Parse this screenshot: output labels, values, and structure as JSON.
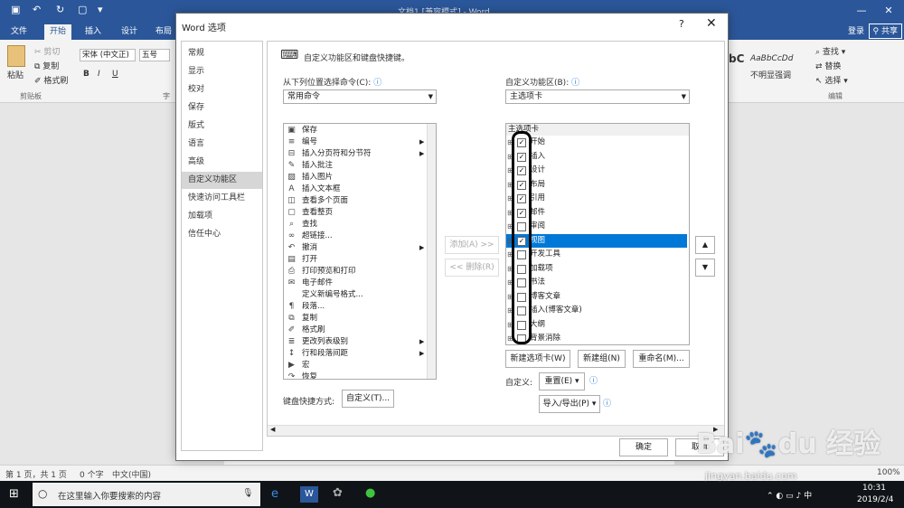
{
  "word": {
    "doc_title": "文档1 [兼容模式] - Word",
    "tabs": [
      "文件",
      "开始",
      "插入",
      "设计",
      "布局"
    ],
    "signin": "登录",
    "share": "共享",
    "ribbon": {
      "paste": "粘贴",
      "cut": "剪切",
      "copy": "复制",
      "format_painter": "格式刷",
      "clipboard": "剪贴板",
      "font_name": "宋体 (中文正)",
      "font_size": "五号",
      "font_group": "字",
      "style_1": "bC",
      "style_2": "AaBbCcDd",
      "style_label": "不明显强调",
      "find": "查找",
      "replace": "替换",
      "select": "选择",
      "edit_group": "编辑"
    },
    "status": {
      "page": "第 1 页，共 1 页",
      "words": "0 个字",
      "lang": "中文(中国)",
      "zoom": "100%"
    }
  },
  "taskbar": {
    "search_placeholder": "在这里输入你要搜索的内容",
    "time": "10:31",
    "date": "2019/2/4"
  },
  "dialog": {
    "title": "Word 选项",
    "help": "?",
    "close": "✕",
    "nav": [
      "常规",
      "显示",
      "校对",
      "保存",
      "版式",
      "语言",
      "高级",
      "自定义功能区",
      "快速访问工具栏",
      "加载项",
      "信任中心"
    ],
    "nav_active": 7,
    "header": "自定义功能区和键盘快捷键。",
    "choose_label": "从下列位置选择命令(C):",
    "choose_value": "常用命令",
    "customize_label": "自定义功能区(B):",
    "customize_value": "主选项卡",
    "commands": [
      {
        "icon": "save-icon",
        "glyph": "▣",
        "label": "保存",
        "sub": false
      },
      {
        "icon": "numbering-icon",
        "glyph": "≡",
        "label": "编号",
        "sub": true
      },
      {
        "icon": "page-break-icon",
        "glyph": "⊟",
        "label": "插入分页符和分节符",
        "sub": true
      },
      {
        "icon": "comment-icon",
        "glyph": "✎",
        "label": "插入批注",
        "sub": false
      },
      {
        "icon": "picture-icon",
        "glyph": "▨",
        "label": "插入图片",
        "sub": false
      },
      {
        "icon": "textbox-icon",
        "glyph": "A",
        "label": "插入文本框",
        "sub": false
      },
      {
        "icon": "multipage-icon",
        "glyph": "◫",
        "label": "查看多个页面",
        "sub": false
      },
      {
        "icon": "fullpage-icon",
        "glyph": "▢",
        "label": "查看整页",
        "sub": false
      },
      {
        "icon": "find-icon",
        "glyph": "⌕",
        "label": "查找",
        "sub": false
      },
      {
        "icon": "hyperlink-icon",
        "glyph": "∞",
        "label": "超链接...",
        "sub": false
      },
      {
        "icon": "undo-icon",
        "glyph": "↶",
        "label": "撤消",
        "sub": true
      },
      {
        "icon": "open-icon",
        "glyph": "▤",
        "label": "打开",
        "sub": false
      },
      {
        "icon": "print-preview-icon",
        "glyph": "⎙",
        "label": "打印预览和打印",
        "sub": false
      },
      {
        "icon": "email-icon",
        "glyph": "✉",
        "label": "电子邮件",
        "sub": false
      },
      {
        "icon": "",
        "glyph": "",
        "label": "定义新编号格式...",
        "sub": false
      },
      {
        "icon": "paragraph-icon",
        "glyph": "¶",
        "label": "段落...",
        "sub": false
      },
      {
        "icon": "copy-icon",
        "glyph": "⧉",
        "label": "复制",
        "sub": false
      },
      {
        "icon": "format-painter-icon",
        "glyph": "✐",
        "label": "格式刷",
        "sub": false
      },
      {
        "icon": "list-level-icon",
        "glyph": "≣",
        "label": "更改列表级别",
        "sub": true
      },
      {
        "icon": "line-spacing-icon",
        "glyph": "↕",
        "label": "行和段落间距",
        "sub": true
      },
      {
        "icon": "macro-icon",
        "glyph": "▶",
        "label": "宏",
        "sub": false
      },
      {
        "icon": "redo-icon",
        "glyph": "↷",
        "label": "恢复",
        "sub": false
      }
    ],
    "add_button": "添加(A) >>",
    "remove_button": "<< 删除(R)",
    "keyboard_label": "键盘快捷方式:",
    "keyboard_button": "自定义(T)...",
    "tab_header": "主选项卡",
    "tabs": [
      {
        "label": "开始",
        "checked": true,
        "selected": false
      },
      {
        "label": "插入",
        "checked": true,
        "selected": false
      },
      {
        "label": "设计",
        "checked": true,
        "selected": false
      },
      {
        "label": "布局",
        "checked": true,
        "selected": false
      },
      {
        "label": "引用",
        "checked": true,
        "selected": false
      },
      {
        "label": "邮件",
        "checked": true,
        "selected": false
      },
      {
        "label": "审阅",
        "checked": false,
        "selected": false
      },
      {
        "label": "视图",
        "checked": true,
        "selected": true
      },
      {
        "label": "开发工具",
        "checked": false,
        "selected": false
      },
      {
        "label": "加载项",
        "checked": false,
        "selected": false
      },
      {
        "label": "书法",
        "checked": false,
        "selected": false
      },
      {
        "label": "博客文章",
        "checked": false,
        "selected": false
      },
      {
        "label": "插入(博客文章)",
        "checked": false,
        "selected": false
      },
      {
        "label": "大纲",
        "checked": false,
        "selected": false
      },
      {
        "label": "背景消除",
        "checked": false,
        "selected": false
      }
    ],
    "new_tab_button": "新建选项卡(W)",
    "new_group_button": "新建组(N)",
    "rename_button": "重命名(M)...",
    "custom_label": "自定义:",
    "reset_button": "重置(E) ▾",
    "import_export_button": "导入/导出(P) ▾",
    "ok_button": "确定",
    "cancel_button": "取消"
  },
  "watermark": {
    "text": "Bai du 经验",
    "url": "jingyan.baidu.com"
  }
}
